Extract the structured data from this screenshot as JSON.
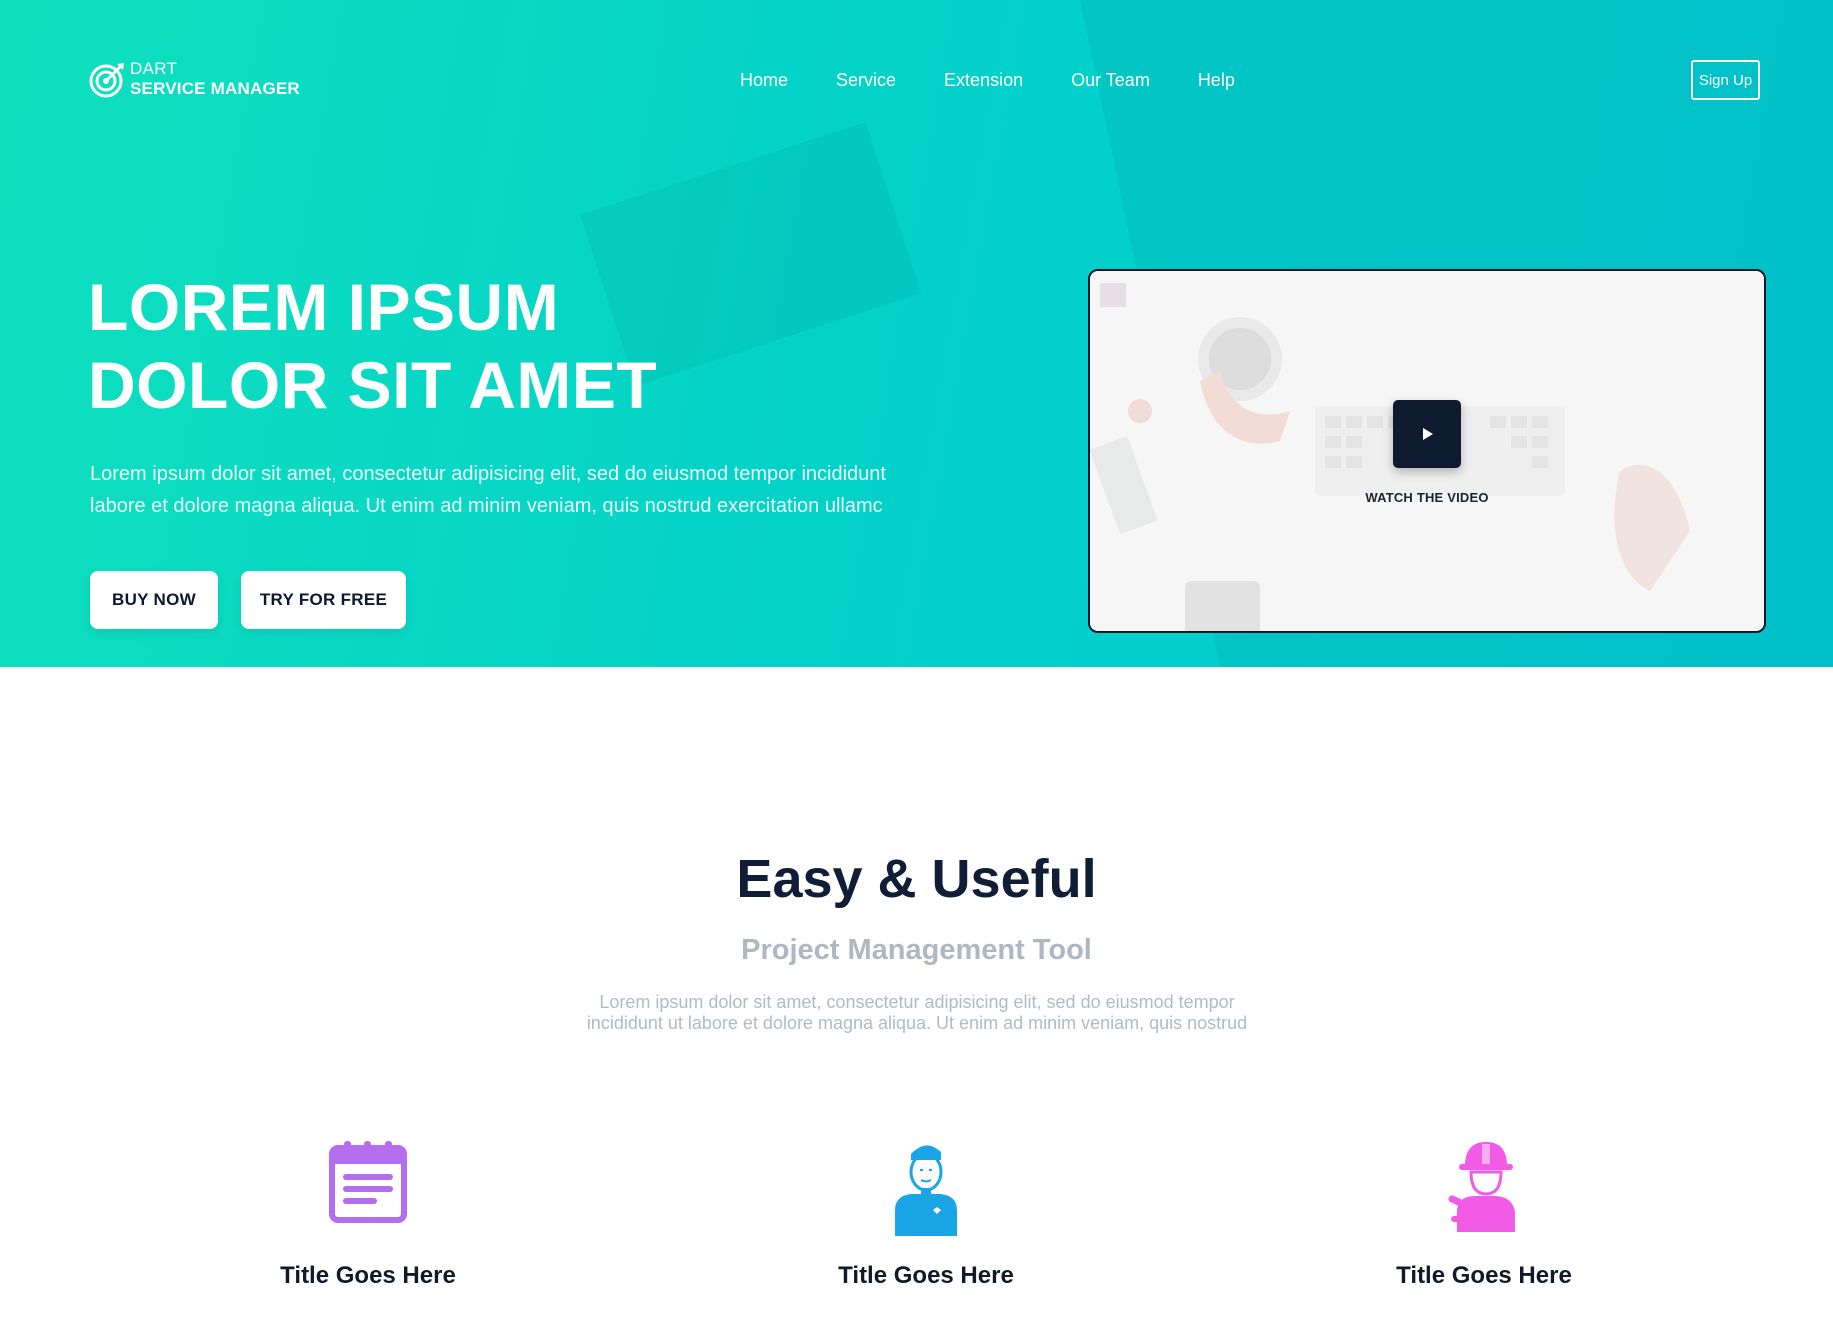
{
  "brand": {
    "line1": "DART",
    "line2": "SERVICE MANAGER"
  },
  "nav": {
    "items": [
      "Home",
      "Service",
      "Extension",
      "Our Team",
      "Help"
    ]
  },
  "header": {
    "signup_label": "Sign Up"
  },
  "hero": {
    "title_line1": "LOREM IPSUM",
    "title_line2": "DOLOR SIT AMET",
    "description_line1": "Lorem ipsum dolor sit amet, consectetur adipisicing elit, sed do eiusmod tempor incididunt",
    "description_line2": "labore et dolore magna aliqua. Ut enim ad minim veniam, quis nostrud exercitation ullamc",
    "buy_label": "BUY NOW",
    "try_label": "TRY FOR FREE",
    "video_label": "WATCH THE VIDEO"
  },
  "section": {
    "title": "Easy & Useful",
    "subtitle": "Project Management Tool",
    "description_line1": "Lorem ipsum dolor sit amet, consectetur adipisicing elit, sed do eiusmod tempor",
    "description_line2": "incididunt ut labore et dolore magna aliqua. Ut enim ad minim veniam, quis nostrud"
  },
  "features": [
    {
      "title": "Title Goes Here",
      "icon": "calendar-icon",
      "color": "#b46ef0"
    },
    {
      "title": "Title Goes Here",
      "icon": "person-icon",
      "color": "#1aa6e6"
    },
    {
      "title": "Title Goes Here",
      "icon": "construction-worker-icon",
      "color": "#f25be6"
    }
  ],
  "colors": {
    "hero_gradient_start": "#0fe0bd",
    "hero_gradient_end": "#00c9d3",
    "dark": "#0d1a30",
    "subtitle_gray": "#aeb7c2"
  }
}
